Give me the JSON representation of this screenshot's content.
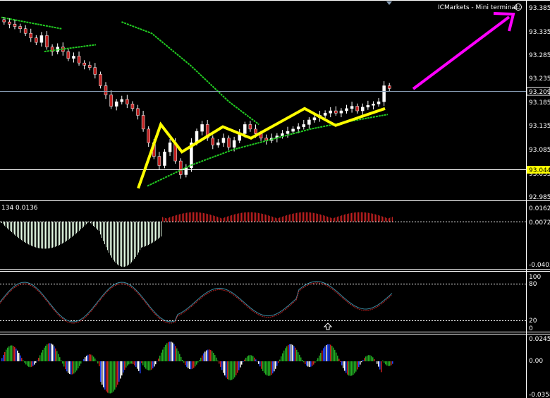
{
  "terminal": {
    "title": "ICMarkets - Mini terminal",
    "smiley_icon": "smiley-icon"
  },
  "colors": {
    "background": "#000000",
    "candles": "#ffffff",
    "candle_down": "#c02020",
    "ma_line": "#22cc22",
    "pattern": "#ffff00",
    "arrow": "#ff00ff",
    "grid": "#ffffff",
    "price_line": "#8aa0b8",
    "level_highlight": "#ffff00"
  },
  "chart_data": [
    {
      "type": "candlestick",
      "panel": "main",
      "ylim": [
        92.965,
        93.4
      ],
      "y_ticks": [
        "93.385",
        "93.335",
        "93.285",
        "93.235",
        "93.185",
        "93.135",
        "93.085",
        "93.035",
        "92.985"
      ],
      "current_price": "93.209",
      "level_price": "93.044",
      "close_series": [
        93.355,
        93.35,
        93.345,
        93.34,
        93.33,
        93.32,
        93.31,
        93.325,
        93.3,
        93.29,
        93.3,
        93.29,
        93.275,
        93.28,
        93.265,
        93.26,
        93.255,
        93.24,
        93.215,
        93.195,
        93.17,
        93.18,
        93.185,
        93.175,
        93.165,
        93.15,
        93.12,
        93.09,
        93.06,
        93.04,
        93.07,
        93.09,
        93.05,
        93.02,
        93.035,
        93.09,
        93.115,
        93.13,
        93.1,
        93.085,
        93.09,
        93.1,
        93.08,
        93.095,
        93.11,
        93.13,
        93.12,
        93.11,
        93.1,
        93.095,
        93.1,
        93.105,
        93.11,
        93.115,
        93.12,
        93.125,
        93.13,
        93.14,
        93.145,
        93.15,
        93.155,
        93.16,
        93.155,
        93.16,
        93.165,
        93.17,
        93.16,
        93.168,
        93.172,
        93.175,
        93.18,
        93.215,
        93.209
      ],
      "ma_segments": [
        [
          [
            0,
            93.365
          ],
          [
            14,
            93.34
          ]
        ],
        [
          [
            28,
            93.355
          ],
          [
            35,
            93.33
          ],
          [
            44,
            93.26
          ],
          [
            53,
            93.18
          ],
          [
            60,
            93.13
          ]
        ],
        [
          [
            10,
            93.29
          ],
          [
            22,
            93.305
          ]
        ],
        [
          [
            34,
            92.995
          ],
          [
            44,
            93.04
          ],
          [
            54,
            93.075
          ],
          [
            62,
            93.095
          ],
          [
            72,
            93.12
          ],
          [
            80,
            93.135
          ],
          [
            90,
            93.152
          ]
        ]
      ],
      "pattern_line": [
        [
          92.99,
          0
        ],
        [
          93.13,
          1
        ],
        [
          93.07,
          2
        ],
        [
          93.125,
          3
        ],
        [
          93.1,
          4
        ],
        [
          93.165,
          5
        ],
        [
          93.128,
          6
        ],
        [
          93.165,
          7
        ]
      ],
      "arrow": "up"
    },
    {
      "type": "histogram",
      "panel": "oscillator-1",
      "label": "134 0.0136",
      "ylim": [
        -0.0403,
        0.0162
      ],
      "y_ticks": [
        "0.0162",
        "0.0072",
        "-0.0403"
      ],
      "zero_line": "0.0072"
    },
    {
      "type": "line",
      "panel": "oscillator-2",
      "ylim": [
        0,
        100
      ],
      "y_ticks": [
        "100",
        "80",
        "20",
        "0"
      ],
      "levels": [
        80,
        20
      ]
    },
    {
      "type": "histogram",
      "panel": "oscillator-3",
      "ylim": [
        -0.0358,
        0.0245
      ],
      "y_ticks": [
        "0.0245",
        "0.00",
        "-0.0358"
      ]
    }
  ]
}
